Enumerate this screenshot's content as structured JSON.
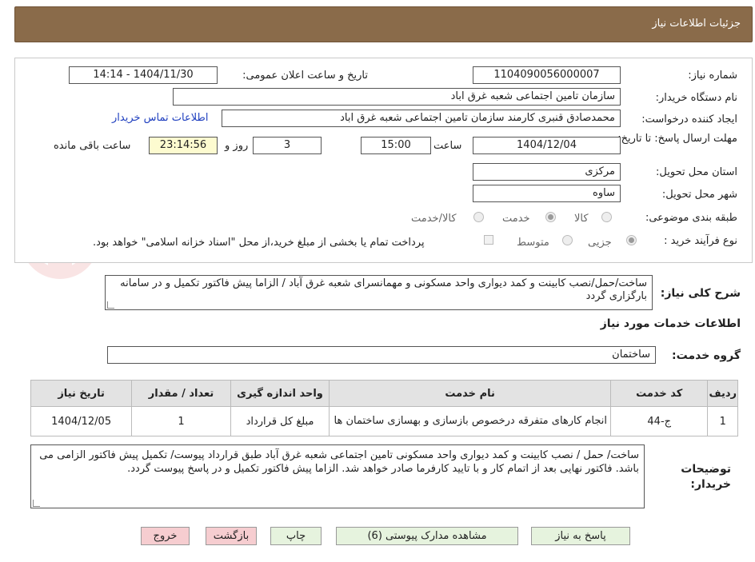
{
  "header": {
    "title": "جزئیات اطلاعات نیاز"
  },
  "fields": {
    "need_number_label": "شماره نیاز:",
    "need_number": "1104090056000007",
    "announce_label": "تاریخ و ساعت اعلان عمومی:",
    "announce_value": "1404/11/30 - 14:14",
    "buyer_org_label": "نام دستگاه خریدار:",
    "buyer_org": "سازمان تامین اجتماعی شعبه غرق اباد",
    "requester_label": "ایجاد کننده درخواست:",
    "requester": "محمدصادق قنبری کارمند سازمان تامین اجتماعی شعبه غرق اباد",
    "buyer_contact_link": "اطلاعات تماس خریدار",
    "deadline_label": "مهلت ارسال پاسخ: تا تاریخ:",
    "deadline_date": "1404/12/04",
    "time_label": "ساعت",
    "deadline_time": "15:00",
    "days_value": "3",
    "days_and_label": "روز و",
    "remaining_time": "23:14:56",
    "remaining_label": "ساعت باقی مانده",
    "province_label": "استان محل تحویل:",
    "province": "مرکزی",
    "city_label": "شهر محل تحویل:",
    "city": "ساوه",
    "category_label": "طبقه بندی موضوعی:",
    "category_options": [
      "کالا",
      "خدمت",
      "کالا/خدمت"
    ],
    "process_label": "نوع فرآیند خرید :",
    "process_options": [
      "جزیی",
      "متوسط"
    ],
    "treasury_note": "پرداخت تمام یا بخشی از مبلغ خرید،از محل \"اسناد خزانه اسلامی\" خواهد بود."
  },
  "summary": {
    "label": "شرح کلی نیاز:",
    "text": "ساخت/حمل/نصب کابینت و کمد دیواری  واحد مسکونی و مهمانسرای شعبه غرق آباد / الزاما پیش فاکتور تکمیل و در سامانه بارگزاری گردد"
  },
  "services": {
    "section_title": "اطلاعات خدمات مورد نیاز",
    "group_label": "گروه خدمت:",
    "group_value": "ساختمان",
    "columns": [
      "ردیف",
      "کد خدمت",
      "نام خدمت",
      "واحد اندازه گیری",
      "تعداد / مقدار",
      "تاریخ نیاز"
    ],
    "rows": [
      {
        "index": "1",
        "code": "ج-44",
        "name": "انجام کارهای متفرقه درخصوص بازسازی و بهسازی ساختمان ها",
        "unit": "مبلغ کل قرارداد",
        "quantity": "1",
        "date": "1404/12/05"
      }
    ]
  },
  "buyer_notes": {
    "label": "توضیحات خریدار:",
    "text": "ساخت/ حمل / نصب کابینت و کمد دیواری واحد مسکونی تامین اجتماعی شعبه غرق آباد طبق قرارداد پیوست/ تکمیل پیش فاکتور الزامی می باشد. فاکتور نهایی بعد از اتمام کار و با تایید کارفرما صادر خواهد شد. الزاما  پیش فاکتور تکمیل و در پاسخ پیوست گردد."
  },
  "buttons": {
    "reply": "پاسخ به نیاز",
    "attachments": "مشاهده مدارک پیوستی (6)",
    "print": "چاپ",
    "back": "بازگشت",
    "exit": "خروج"
  },
  "colors": {
    "header_bg": "#8a6b4a",
    "link": "#1f3fbf",
    "green_btn": "#e6f3de",
    "pink_btn": "#f6cdd0"
  }
}
